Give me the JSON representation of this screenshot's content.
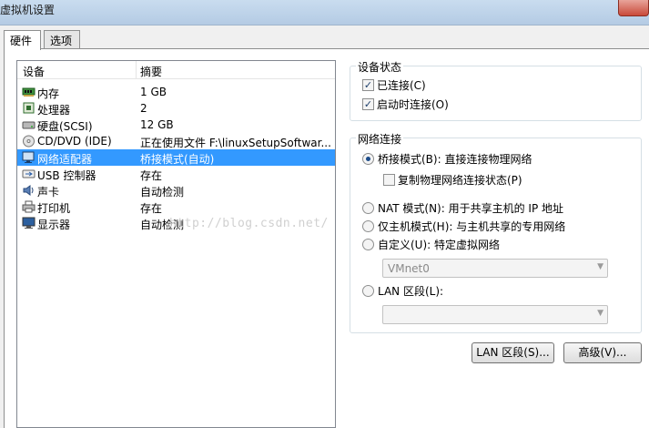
{
  "window": {
    "title": "虚拟机设置"
  },
  "tabs": [
    {
      "label": "硬件"
    },
    {
      "label": "选项"
    }
  ],
  "device_list": {
    "headers": {
      "device": "设备",
      "summary": "摘要"
    },
    "rows": [
      {
        "name": "内存",
        "summary": "1 GB",
        "icon": "memory-icon"
      },
      {
        "name": "处理器",
        "summary": "2",
        "icon": "processor-icon"
      },
      {
        "name": "硬盘(SCSI)",
        "summary": "12 GB",
        "icon": "harddisk-icon"
      },
      {
        "name": "CD/DVD (IDE)",
        "summary": "正在使用文件 F:\\linuxSetupSoftwar...",
        "icon": "cd-dvd-icon"
      },
      {
        "name": "网络适配器",
        "summary": "桥接模式(自动)",
        "icon": "network-adapter-icon"
      },
      {
        "name": "USB 控制器",
        "summary": "存在",
        "icon": "usb-icon"
      },
      {
        "name": "声卡",
        "summary": "自动检测",
        "icon": "sound-card-icon"
      },
      {
        "name": "打印机",
        "summary": "存在",
        "icon": "printer-icon"
      },
      {
        "name": "显示器",
        "summary": "自动检测",
        "icon": "display-icon"
      }
    ]
  },
  "device_status": {
    "title": "设备状态",
    "connected": {
      "label": "已连接(C)",
      "checked": true
    },
    "connect_at_power_on": {
      "label": "启动时连接(O)",
      "checked": true
    }
  },
  "network_connection": {
    "title": "网络连接",
    "bridged": {
      "label": "桥接模式(B): 直接连接物理网络",
      "selected": true
    },
    "replicate": {
      "label": "复制物理网络连接状态(P)",
      "checked": false
    },
    "nat": {
      "label": "NAT 模式(N): 用于共享主机的 IP 地址",
      "selected": false
    },
    "host_only": {
      "label": "仅主机模式(H): 与主机共享的专用网络",
      "selected": false
    },
    "custom": {
      "label": "自定义(U): 特定虚拟网络",
      "selected": false
    },
    "custom_network_value": "VMnet0",
    "lan_segment": {
      "label": "LAN 区段(L):",
      "selected": false
    },
    "lan_segment_value": ""
  },
  "buttons": {
    "lan_segments": "LAN 区段(S)...",
    "advanced": "高级(V)..."
  },
  "watermark": "http://blog.csdn.net/"
}
